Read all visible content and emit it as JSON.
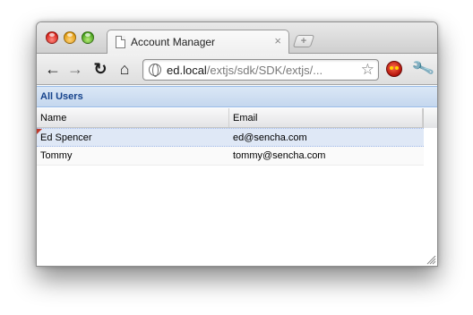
{
  "browser": {
    "tab": {
      "title": "Account Manager",
      "close_glyph": "×"
    },
    "new_tab_glyph": "+",
    "toolbar": {
      "back_glyph": "←",
      "forward_glyph": "→",
      "reload_glyph": "↻",
      "home_glyph": "⌂",
      "bookmark_glyph": "☆",
      "wrench_glyph": "🔧"
    },
    "url": {
      "host": "ed.local",
      "path": "/extjs/sdk/SDK/extjs/..."
    },
    "icons": [
      "page-icon",
      "globe-icon",
      "star-icon",
      "extension-icon",
      "wrench-icon"
    ]
  },
  "grid": {
    "title": "All Users",
    "columns": [
      "Name",
      "Email"
    ],
    "rows": [
      {
        "name": "Ed Spencer",
        "email": "ed@sencha.com",
        "selected": true,
        "dirty": true
      },
      {
        "name": "Tommy",
        "email": "tommy@sencha.com",
        "selected": false,
        "dirty": false
      }
    ]
  },
  "colors": {
    "panel_title": "#15428b",
    "panel_header": "#c5d7ee",
    "selected_row": "#dfe8f6",
    "dirty_marker": "#c0392b"
  }
}
